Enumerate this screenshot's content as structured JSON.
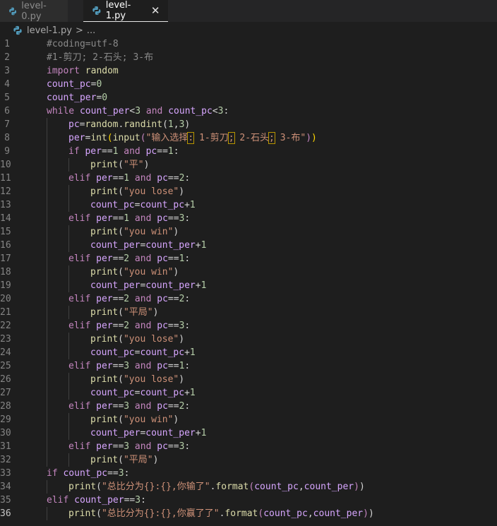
{
  "tabs": [
    {
      "label": "level-0.py",
      "active": false
    },
    {
      "label": "level-1.py",
      "active": true
    }
  ],
  "breadcrumb": {
    "file": "level-1.py",
    "sep": ">",
    "more": "..."
  },
  "current_line": 36,
  "code_lines": [
    {
      "n": 1,
      "indent": 0,
      "tokens": [
        {
          "t": "#coding=utf-8",
          "k": "comment"
        }
      ]
    },
    {
      "n": 2,
      "indent": 0,
      "tokens": [
        {
          "t": "#1-剪刀; 2-石头; 3-布",
          "k": "comment"
        }
      ]
    },
    {
      "n": 3,
      "indent": 0,
      "tokens": [
        {
          "t": "import",
          "k": "kw"
        },
        {
          "t": " ",
          "k": "plain"
        },
        {
          "t": "random",
          "k": "fn"
        }
      ]
    },
    {
      "n": 4,
      "indent": 0,
      "tokens": [
        {
          "t": "count_pc",
          "k": "var"
        },
        {
          "t": "=",
          "k": "op"
        },
        {
          "t": "0",
          "k": "num"
        }
      ]
    },
    {
      "n": 5,
      "indent": 0,
      "tokens": [
        {
          "t": "count_per",
          "k": "var"
        },
        {
          "t": "=",
          "k": "op"
        },
        {
          "t": "0",
          "k": "num"
        }
      ]
    },
    {
      "n": 6,
      "indent": 0,
      "tokens": [
        {
          "t": "while",
          "k": "kw"
        },
        {
          "t": " ",
          "k": "plain"
        },
        {
          "t": "count_per",
          "k": "var"
        },
        {
          "t": "<",
          "k": "op"
        },
        {
          "t": "3",
          "k": "num"
        },
        {
          "t": " and ",
          "k": "kw"
        },
        {
          "t": "count_pc",
          "k": "var"
        },
        {
          "t": "<",
          "k": "op"
        },
        {
          "t": "3",
          "k": "num"
        },
        {
          "t": ":",
          "k": "plain"
        }
      ]
    },
    {
      "n": 7,
      "indent": 1,
      "tokens": [
        {
          "t": "pc",
          "k": "var"
        },
        {
          "t": "=",
          "k": "op"
        },
        {
          "t": "random",
          "k": "fn"
        },
        {
          "t": ".",
          "k": "plain"
        },
        {
          "t": "randint",
          "k": "fn"
        },
        {
          "t": "(",
          "k": "plain"
        },
        {
          "t": "1",
          "k": "num"
        },
        {
          "t": ",",
          "k": "plain"
        },
        {
          "t": "3",
          "k": "num"
        },
        {
          "t": ")",
          "k": "plain"
        }
      ]
    },
    {
      "n": 8,
      "indent": 1,
      "tokens": [
        {
          "t": "per",
          "k": "var"
        },
        {
          "t": "=",
          "k": "op"
        },
        {
          "t": "int",
          "k": "fn"
        },
        {
          "t": "(",
          "k": "fnb"
        },
        {
          "t": "input",
          "k": "fn"
        },
        {
          "t": "(",
          "k": "kw"
        },
        {
          "t": "\"输入选择",
          "k": "str"
        },
        {
          "t": ":",
          "k": "strwarn"
        },
        {
          "t": " 1-剪刀",
          "k": "str"
        },
        {
          "t": ";",
          "k": "strwarn"
        },
        {
          "t": " 2-石头",
          "k": "str"
        },
        {
          "t": ";",
          "k": "strwarn"
        },
        {
          "t": " 3-布\"",
          "k": "str"
        },
        {
          "t": ")",
          "k": "kw"
        },
        {
          "t": ")",
          "k": "fnb"
        }
      ]
    },
    {
      "n": 9,
      "indent": 1,
      "tokens": [
        {
          "t": "if",
          "k": "kw"
        },
        {
          "t": " ",
          "k": "plain"
        },
        {
          "t": "per",
          "k": "var"
        },
        {
          "t": "==",
          "k": "op"
        },
        {
          "t": "1",
          "k": "num"
        },
        {
          "t": " and ",
          "k": "kw"
        },
        {
          "t": "pc",
          "k": "var"
        },
        {
          "t": "==",
          "k": "op"
        },
        {
          "t": "1",
          "k": "num"
        },
        {
          "t": ":",
          "k": "plain"
        }
      ]
    },
    {
      "n": 10,
      "indent": 2,
      "tokens": [
        {
          "t": "print",
          "k": "fn"
        },
        {
          "t": "(",
          "k": "plain"
        },
        {
          "t": "\"平\"",
          "k": "str"
        },
        {
          "t": ")",
          "k": "plain"
        }
      ]
    },
    {
      "n": 11,
      "indent": 1,
      "tokens": [
        {
          "t": "elif",
          "k": "kw"
        },
        {
          "t": " ",
          "k": "plain"
        },
        {
          "t": "per",
          "k": "var"
        },
        {
          "t": "==",
          "k": "op"
        },
        {
          "t": "1",
          "k": "num"
        },
        {
          "t": " and ",
          "k": "kw"
        },
        {
          "t": "pc",
          "k": "var"
        },
        {
          "t": "==",
          "k": "op"
        },
        {
          "t": "2",
          "k": "num"
        },
        {
          "t": ":",
          "k": "plain"
        }
      ]
    },
    {
      "n": 12,
      "indent": 2,
      "tokens": [
        {
          "t": "print",
          "k": "fn"
        },
        {
          "t": "(",
          "k": "plain"
        },
        {
          "t": "\"you lose\"",
          "k": "str"
        },
        {
          "t": ")",
          "k": "plain"
        }
      ]
    },
    {
      "n": 13,
      "indent": 2,
      "tokens": [
        {
          "t": "count_pc",
          "k": "var"
        },
        {
          "t": "=",
          "k": "op"
        },
        {
          "t": "count_pc",
          "k": "var"
        },
        {
          "t": "+",
          "k": "op"
        },
        {
          "t": "1",
          "k": "num"
        }
      ]
    },
    {
      "n": 14,
      "indent": 1,
      "tokens": [
        {
          "t": "elif",
          "k": "kw"
        },
        {
          "t": " ",
          "k": "plain"
        },
        {
          "t": "per",
          "k": "var"
        },
        {
          "t": "==",
          "k": "op"
        },
        {
          "t": "1",
          "k": "num"
        },
        {
          "t": " and ",
          "k": "kw"
        },
        {
          "t": "pc",
          "k": "var"
        },
        {
          "t": "==",
          "k": "op"
        },
        {
          "t": "3",
          "k": "num"
        },
        {
          "t": ":",
          "k": "plain"
        }
      ]
    },
    {
      "n": 15,
      "indent": 2,
      "tokens": [
        {
          "t": "print",
          "k": "fn"
        },
        {
          "t": "(",
          "k": "plain"
        },
        {
          "t": "\"you win\"",
          "k": "str"
        },
        {
          "t": ")",
          "k": "plain"
        }
      ]
    },
    {
      "n": 16,
      "indent": 2,
      "tokens": [
        {
          "t": "count_per",
          "k": "var"
        },
        {
          "t": "=",
          "k": "op"
        },
        {
          "t": "count_per",
          "k": "var"
        },
        {
          "t": "+",
          "k": "op"
        },
        {
          "t": "1",
          "k": "num"
        }
      ]
    },
    {
      "n": 17,
      "indent": 1,
      "tokens": [
        {
          "t": "elif",
          "k": "kw"
        },
        {
          "t": " ",
          "k": "plain"
        },
        {
          "t": "per",
          "k": "var"
        },
        {
          "t": "==",
          "k": "op"
        },
        {
          "t": "2",
          "k": "num"
        },
        {
          "t": " and ",
          "k": "kw"
        },
        {
          "t": "pc",
          "k": "var"
        },
        {
          "t": "==",
          "k": "op"
        },
        {
          "t": "1",
          "k": "num"
        },
        {
          "t": ":",
          "k": "plain"
        }
      ]
    },
    {
      "n": 18,
      "indent": 2,
      "tokens": [
        {
          "t": "print",
          "k": "fn"
        },
        {
          "t": "(",
          "k": "plain"
        },
        {
          "t": "\"you win\"",
          "k": "str"
        },
        {
          "t": ")",
          "k": "plain"
        }
      ]
    },
    {
      "n": 19,
      "indent": 2,
      "tokens": [
        {
          "t": "count_per",
          "k": "var"
        },
        {
          "t": "=",
          "k": "op"
        },
        {
          "t": "count_per",
          "k": "var"
        },
        {
          "t": "+",
          "k": "op"
        },
        {
          "t": "1",
          "k": "num"
        }
      ]
    },
    {
      "n": 20,
      "indent": 1,
      "tokens": [
        {
          "t": "elif",
          "k": "kw"
        },
        {
          "t": " ",
          "k": "plain"
        },
        {
          "t": "per",
          "k": "var"
        },
        {
          "t": "==",
          "k": "op"
        },
        {
          "t": "2",
          "k": "num"
        },
        {
          "t": " and ",
          "k": "kw"
        },
        {
          "t": "pc",
          "k": "var"
        },
        {
          "t": "==",
          "k": "op"
        },
        {
          "t": "2",
          "k": "num"
        },
        {
          "t": ":",
          "k": "plain"
        }
      ]
    },
    {
      "n": 21,
      "indent": 2,
      "tokens": [
        {
          "t": "print",
          "k": "fn"
        },
        {
          "t": "(",
          "k": "plain"
        },
        {
          "t": "\"平局\"",
          "k": "str"
        },
        {
          "t": ")",
          "k": "plain"
        }
      ]
    },
    {
      "n": 22,
      "indent": 1,
      "tokens": [
        {
          "t": "elif",
          "k": "kw"
        },
        {
          "t": " ",
          "k": "plain"
        },
        {
          "t": "per",
          "k": "var"
        },
        {
          "t": "==",
          "k": "op"
        },
        {
          "t": "2",
          "k": "num"
        },
        {
          "t": " and ",
          "k": "kw"
        },
        {
          "t": "pc",
          "k": "var"
        },
        {
          "t": "==",
          "k": "op"
        },
        {
          "t": "3",
          "k": "num"
        },
        {
          "t": ":",
          "k": "plain"
        }
      ]
    },
    {
      "n": 23,
      "indent": 2,
      "tokens": [
        {
          "t": "print",
          "k": "fn"
        },
        {
          "t": "(",
          "k": "plain"
        },
        {
          "t": "\"you lose\"",
          "k": "str"
        },
        {
          "t": ")",
          "k": "plain"
        }
      ]
    },
    {
      "n": 24,
      "indent": 2,
      "tokens": [
        {
          "t": "count_pc",
          "k": "var"
        },
        {
          "t": "=",
          "k": "op"
        },
        {
          "t": "count_pc",
          "k": "var"
        },
        {
          "t": "+",
          "k": "op"
        },
        {
          "t": "1",
          "k": "num"
        }
      ]
    },
    {
      "n": 25,
      "indent": 1,
      "tokens": [
        {
          "t": "elif",
          "k": "kw"
        },
        {
          "t": " ",
          "k": "plain"
        },
        {
          "t": "per",
          "k": "var"
        },
        {
          "t": "==",
          "k": "op"
        },
        {
          "t": "3",
          "k": "num"
        },
        {
          "t": " and ",
          "k": "kw"
        },
        {
          "t": "pc",
          "k": "var"
        },
        {
          "t": "==",
          "k": "op"
        },
        {
          "t": "1",
          "k": "num"
        },
        {
          "t": ":",
          "k": "plain"
        }
      ]
    },
    {
      "n": 26,
      "indent": 2,
      "tokens": [
        {
          "t": "print",
          "k": "fn"
        },
        {
          "t": "(",
          "k": "plain"
        },
        {
          "t": "\"you lose\"",
          "k": "str"
        },
        {
          "t": ")",
          "k": "plain"
        }
      ]
    },
    {
      "n": 27,
      "indent": 2,
      "tokens": [
        {
          "t": "count_pc",
          "k": "var"
        },
        {
          "t": "=",
          "k": "op"
        },
        {
          "t": "count_pc",
          "k": "var"
        },
        {
          "t": "+",
          "k": "op"
        },
        {
          "t": "1",
          "k": "num"
        }
      ]
    },
    {
      "n": 28,
      "indent": 1,
      "tokens": [
        {
          "t": "elif",
          "k": "kw"
        },
        {
          "t": " ",
          "k": "plain"
        },
        {
          "t": "per",
          "k": "var"
        },
        {
          "t": "==",
          "k": "op"
        },
        {
          "t": "3",
          "k": "num"
        },
        {
          "t": " and ",
          "k": "kw"
        },
        {
          "t": "pc",
          "k": "var"
        },
        {
          "t": "==",
          "k": "op"
        },
        {
          "t": "2",
          "k": "num"
        },
        {
          "t": ":",
          "k": "plain"
        }
      ]
    },
    {
      "n": 29,
      "indent": 2,
      "tokens": [
        {
          "t": "print",
          "k": "fn"
        },
        {
          "t": "(",
          "k": "plain"
        },
        {
          "t": "\"you win\"",
          "k": "str"
        },
        {
          "t": ")",
          "k": "plain"
        }
      ]
    },
    {
      "n": 30,
      "indent": 2,
      "tokens": [
        {
          "t": "count_per",
          "k": "var"
        },
        {
          "t": "=",
          "k": "op"
        },
        {
          "t": "count_per",
          "k": "var"
        },
        {
          "t": "+",
          "k": "op"
        },
        {
          "t": "1",
          "k": "num"
        }
      ]
    },
    {
      "n": 31,
      "indent": 1,
      "tokens": [
        {
          "t": "elif",
          "k": "kw"
        },
        {
          "t": " ",
          "k": "plain"
        },
        {
          "t": "per",
          "k": "var"
        },
        {
          "t": "==",
          "k": "op"
        },
        {
          "t": "3",
          "k": "num"
        },
        {
          "t": " and ",
          "k": "kw"
        },
        {
          "t": "pc",
          "k": "var"
        },
        {
          "t": "==",
          "k": "op"
        },
        {
          "t": "3",
          "k": "num"
        },
        {
          "t": ":",
          "k": "plain"
        }
      ]
    },
    {
      "n": 32,
      "indent": 2,
      "tokens": [
        {
          "t": "print",
          "k": "fn"
        },
        {
          "t": "(",
          "k": "plain"
        },
        {
          "t": "\"平局\"",
          "k": "str"
        },
        {
          "t": ")",
          "k": "plain"
        }
      ]
    },
    {
      "n": 33,
      "indent": 0,
      "tokens": [
        {
          "t": "if",
          "k": "kw"
        },
        {
          "t": " ",
          "k": "plain"
        },
        {
          "t": "count_pc",
          "k": "var"
        },
        {
          "t": "==",
          "k": "op"
        },
        {
          "t": "3",
          "k": "num"
        },
        {
          "t": ":",
          "k": "plain"
        }
      ]
    },
    {
      "n": 34,
      "indent": 1,
      "tokens": [
        {
          "t": "print",
          "k": "fn"
        },
        {
          "t": "(",
          "k": "plain"
        },
        {
          "t": "\"总比分为{}:{},你输了\"",
          "k": "str"
        },
        {
          "t": ".",
          "k": "plain"
        },
        {
          "t": "format",
          "k": "fn"
        },
        {
          "t": "(",
          "k": "kw"
        },
        {
          "t": "count_pc",
          "k": "var"
        },
        {
          "t": ",",
          "k": "plain"
        },
        {
          "t": "count_per",
          "k": "var"
        },
        {
          "t": ")",
          "k": "kw"
        },
        {
          "t": ")",
          "k": "plain"
        }
      ]
    },
    {
      "n": 35,
      "indent": 0,
      "tokens": [
        {
          "t": "elif",
          "k": "kw"
        },
        {
          "t": " ",
          "k": "plain"
        },
        {
          "t": "count_per",
          "k": "var"
        },
        {
          "t": "==",
          "k": "op"
        },
        {
          "t": "3",
          "k": "num"
        },
        {
          "t": ":",
          "k": "plain"
        }
      ]
    },
    {
      "n": 36,
      "indent": 1,
      "tokens": [
        {
          "t": "print",
          "k": "fn"
        },
        {
          "t": "(",
          "k": "plain"
        },
        {
          "t": "\"总比分为{}:{},你赢了了\"",
          "k": "str"
        },
        {
          "t": ".",
          "k": "plain"
        },
        {
          "t": "format",
          "k": "fn"
        },
        {
          "t": "(",
          "k": "kw"
        },
        {
          "t": "count_pc",
          "k": "var"
        },
        {
          "t": ",",
          "k": "plain"
        },
        {
          "t": "count_per",
          "k": "var"
        },
        {
          "t": ")",
          "k": "kw"
        },
        {
          "t": ")",
          "k": "plain"
        }
      ]
    }
  ]
}
